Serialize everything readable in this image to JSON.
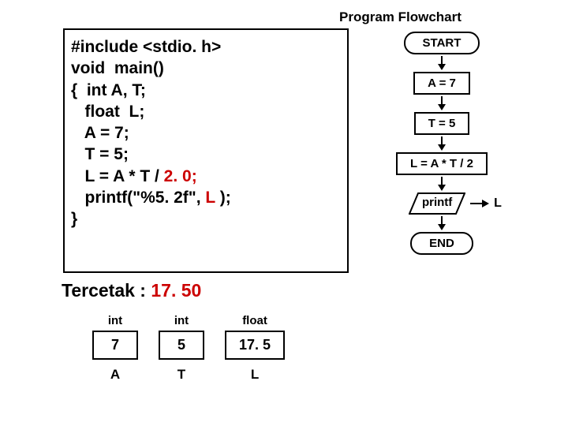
{
  "title": "Program Flowchart",
  "code": {
    "l1": "#include <stdio. h>",
    "l2": "void  main()",
    "l3": "{  int A, T;",
    "l4": "   float  L;",
    "l5": "   A = 7;",
    "l6": "   T = 5;",
    "l7a": "   L = A * T / ",
    "l7b": "2. 0;",
    "l8a": "   printf(\"%5. 2f\", ",
    "l8b": "L",
    "l8c": " );",
    "l9": "}"
  },
  "flow": {
    "start": "START",
    "n1": "A = 7",
    "n2": "T = 5",
    "n3": "L = A * T / 2",
    "io": "printf",
    "ioout": "L",
    "end": "END"
  },
  "result": {
    "label": "Tercetak :   ",
    "value": "17. 50"
  },
  "cells": {
    "h1": "int",
    "h2": "int",
    "h3": "float",
    "v1": "7",
    "v2": "5",
    "v3": "17. 5",
    "lab1": "A",
    "lab2": "T",
    "lab3": "L"
  }
}
